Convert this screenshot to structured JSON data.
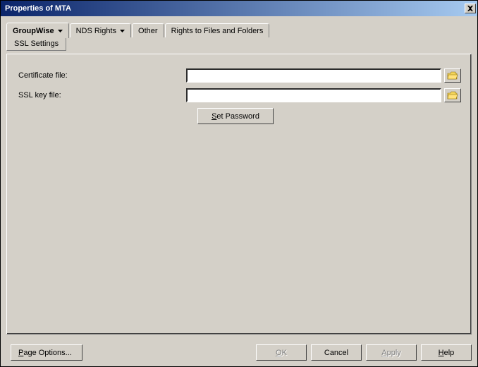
{
  "window": {
    "title": "Properties of MTA"
  },
  "tabs": {
    "groupwise": "GroupWise",
    "nds_rights": "NDS Rights",
    "other": "Other",
    "rights_files": "Rights to Files and Folders"
  },
  "subtab": {
    "ssl_settings": "SSL Settings"
  },
  "form": {
    "cert_label": "Certificate file:",
    "cert_value": "",
    "key_label": "SSL key file:",
    "key_value": "",
    "set_password_prefix": "S",
    "set_password_suffix": "et Password"
  },
  "buttons": {
    "page_options_prefix": "P",
    "page_options_suffix": "age Options...",
    "ok_prefix": "O",
    "ok_suffix": "K",
    "cancel": "Cancel",
    "apply_prefix": "A",
    "apply_suffix": "pply",
    "help_prefix": "H",
    "help_suffix": "elp"
  },
  "icons": {
    "close": "close",
    "dropdown": "chevron-down",
    "folder": "folder-open"
  }
}
